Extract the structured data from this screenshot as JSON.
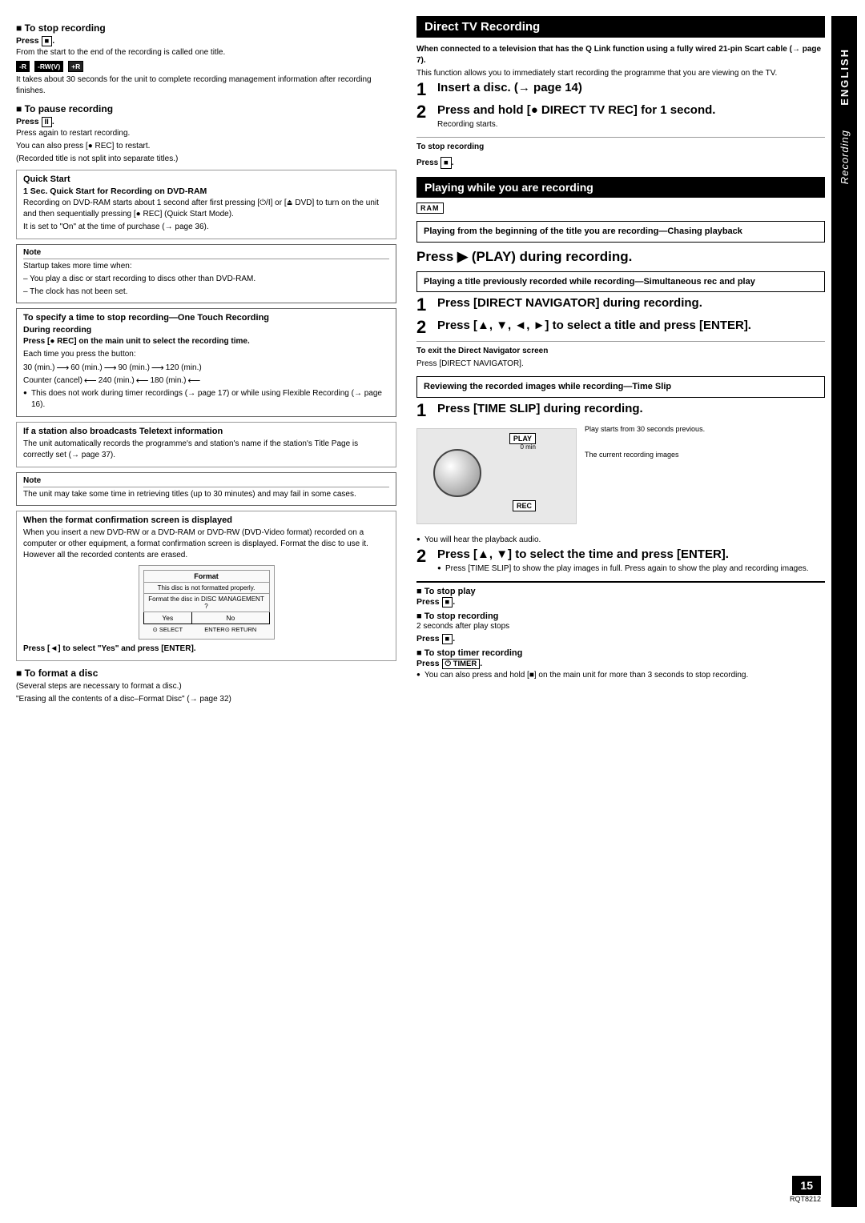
{
  "page": {
    "number": "15",
    "code": "RQT8212"
  },
  "side_tab": {
    "language": "ENGLISH",
    "section": "Recording"
  },
  "left_col": {
    "stop_recording": {
      "heading": "To stop recording",
      "press_label": "Press",
      "press_symbol": "■",
      "line1": "From the start to the end of the recording is called one title.",
      "disc_badges": [
        "-R",
        "-RW(V)",
        "+R"
      ],
      "line2": "It takes about 30 seconds for the unit to complete recording management information after recording finishes."
    },
    "pause_recording": {
      "heading": "To pause recording",
      "press_label": "Press",
      "press_symbol": "II",
      "line1": "Press again to restart recording.",
      "line2": "You can also press [● REC] to restart.",
      "line3": "(Recorded title is not split into separate titles.)"
    },
    "quick_start": {
      "title": "Quick Start",
      "subtitle": "1 Sec. Quick Start for Recording on DVD-RAM",
      "body": "Recording on DVD-RAM starts about 1 second after first pressing [⏻/I] or [⏏ DVD] to turn on the unit and then sequentially pressing [● REC] (Quick Start Mode).",
      "note": "It is set to \"On\" at the time of purchase (→ page 36)."
    },
    "note_startup": {
      "label": "Note",
      "items": [
        "Startup takes more time when:",
        "– You play a disc or start recording to discs other than DVD-RAM.",
        "– The clock has not been set."
      ]
    },
    "one_touch": {
      "title": "To specify a time to stop recording—One Touch Recording",
      "during_recording_label": "During recording",
      "during_recording_text": "Press [● REC] on the main unit to select the recording time.",
      "each_time": "Each time you press the button:",
      "time_line": "30 (min.) ⟶ 60 (min.) ⟶ 90 (min.) ⟶ 120 (min.)",
      "counter_line": "Counter (cancel) ⟵ 240 (min.) ⟵ 180 (min.) ⟵",
      "bullet1": "This does not work during timer recordings (→ page 17) or while using Flexible Recording (→ page 16)."
    },
    "teletext": {
      "title": "If a station also broadcasts Teletext information",
      "body": "The unit automatically records the programme's and station's name if the station's Title Page is correctly set (→ page 37)."
    },
    "note_teletext": {
      "label": "Note",
      "body": "The unit may take some time in retrieving titles (up to 30 minutes) and may fail in some cases."
    },
    "format_confirmation": {
      "title": "When the format confirmation screen is displayed",
      "body": "When you insert a new DVD-RW or a DVD-RAM or DVD-RW (DVD-Video format) recorded on a computer or other equipment, a format confirmation screen is displayed. Format the disc to use it. However all the recorded contents are erased.",
      "format_dialog": {
        "title": "Format",
        "line1": "This disc is not formatted properly.",
        "line2": "Format the disc in DISC MANAGEMENT ?",
        "yes": "Yes",
        "no": "No",
        "select_label": "SELECT",
        "enter_label": "ENTER⊙",
        "return_label": "RETURN"
      },
      "press_instruction": "Press [◄] to select \"Yes\" and press [ENTER]."
    },
    "format_disc": {
      "heading": "To format a disc",
      "line1": "(Several steps are necessary to format a disc.)",
      "line2": "\"Erasing all the contents of a disc–Format Disc\" (→ page 32)"
    }
  },
  "right_col": {
    "direct_tv": {
      "header": "Direct TV Recording",
      "intro1": "When connected to a television that has the Q Link function using a fully wired 21-pin Scart cable (→ page 7).",
      "intro2": "This function allows you to immediately start recording the programme that you are viewing on the TV.",
      "steps": [
        {
          "number": "1",
          "text": "Insert a disc. (→ page 14)"
        },
        {
          "number": "2",
          "text": "Press and hold [● DIRECT TV REC] for 1 second.",
          "note": "Recording starts."
        }
      ],
      "stop_label": "To stop recording",
      "stop_press": "Press [■]."
    },
    "playing_while_recording": {
      "header": "Playing while you are recording",
      "ram_badge": "RAM",
      "chasing_playback": {
        "label": "Playing from the beginning of the title you are recording—Chasing playback",
        "press_heading": "Press ▶ (PLAY) during recording."
      },
      "simultaneous": {
        "label": "Playing a title previously recorded while recording—Simultaneous rec and play",
        "steps": [
          {
            "number": "1",
            "text": "Press [DIRECT NAVIGATOR] during recording."
          },
          {
            "number": "2",
            "text": "Press [▲, ▼, ◄, ►] to select a title and press [ENTER]."
          }
        ],
        "exit_label": "To exit the Direct Navigator screen",
        "exit_text": "Press [DIRECT NAVIGATOR]."
      },
      "time_slip": {
        "label": "Reviewing the recorded images while recording—Time Slip",
        "step": {
          "number": "1",
          "text": "Press [TIME SLIP] during recording."
        },
        "play_note1": "Play starts from 30 seconds previous.",
        "play_note2": "The current recording images",
        "play_badge": "PLAY",
        "play_0min": "0 min",
        "rec_badge": "REC",
        "bullet": "You will hear the playback audio.",
        "step2": {
          "number": "2",
          "text": "Press [▲, ▼] to select the time and press [ENTER].",
          "bullet": "Press [TIME SLIP] to show the play images in full. Press again to show the play and recording images."
        }
      },
      "stop_play": {
        "heading": "To stop play",
        "press": "Press [■]."
      },
      "stop_recording": {
        "heading": "To stop recording",
        "line1": "2 seconds after play stops",
        "press": "Press [■]."
      },
      "stop_timer": {
        "heading": "To stop timer recording",
        "press": "Press [⏻ TIMER].",
        "bullet": "You can also press and hold [■] on the main unit for more than 3 seconds to stop recording."
      }
    }
  }
}
